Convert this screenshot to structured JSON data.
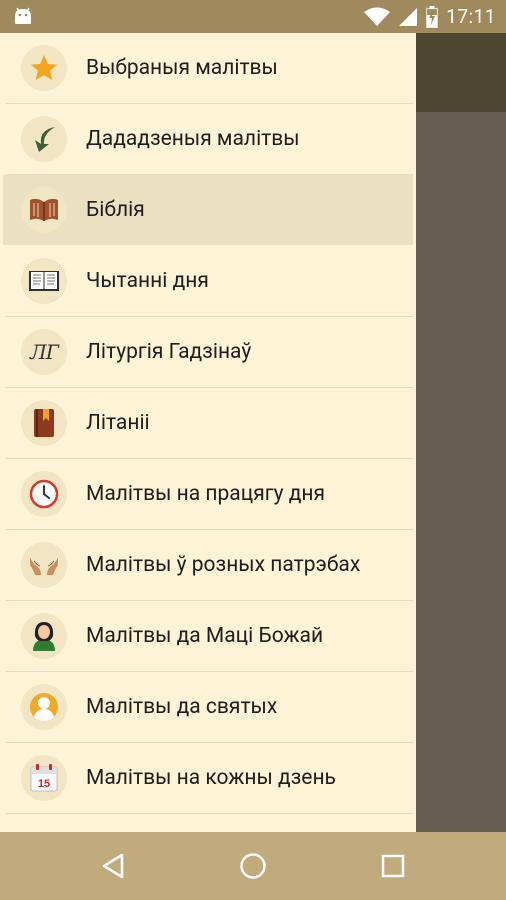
{
  "status_bar": {
    "time": "17:11"
  },
  "drawer": {
    "items": [
      {
        "label": "Выбраныя малітвы",
        "icon": "star-icon"
      },
      {
        "label": "Дададзеныя малітвы",
        "icon": "added-arrow-icon"
      },
      {
        "label": "Біблія",
        "icon": "bible-book-icon",
        "selected": true
      },
      {
        "label": "Чытанні дня",
        "icon": "open-book-icon"
      },
      {
        "label": "Літургія Гадзінаў",
        "icon": "liturgy-monogram-icon",
        "monogram": "ЛГ"
      },
      {
        "label": "Літаніі",
        "icon": "litany-book-icon"
      },
      {
        "label": "Малітвы на працягу дня",
        "icon": "clock-icon"
      },
      {
        "label": "Малітвы ў розных патрэбах",
        "icon": "praying-hands-icon"
      },
      {
        "label": "Малітвы да Маці Божай",
        "icon": "mother-of-god-icon"
      },
      {
        "label": "Малітвы да святых",
        "icon": "saint-person-icon"
      },
      {
        "label": "Малітвы на кожны дзень",
        "icon": "calendar-icon",
        "calendar_day": "15"
      }
    ]
  },
  "navigation_bar": {
    "buttons": [
      "back",
      "home",
      "recents"
    ]
  }
}
